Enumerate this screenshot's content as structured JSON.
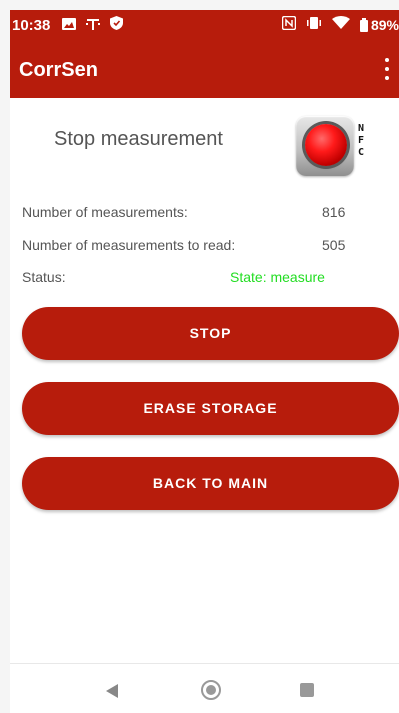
{
  "statusbar": {
    "time": "10:38",
    "battery": "89%",
    "left_icons": [
      "image-icon",
      "t-mobile-icon",
      "shield-icon"
    ],
    "right_icons": [
      "nfc-icon",
      "vibrate-icon",
      "wifi-icon",
      "battery-icon"
    ]
  },
  "appbar": {
    "title": "CorrSen"
  },
  "main": {
    "header": "Stop measurement",
    "nfc_letters": [
      "N",
      "F",
      "C"
    ],
    "nfc_led_color": "#ff1a1a",
    "rows": [
      {
        "label": "Number of measurements:",
        "value": "816"
      },
      {
        "label": "Number of measurements to read:",
        "value": "505"
      }
    ],
    "status": {
      "label": "Status:",
      "value": "State:  measure",
      "color": "#22dd22"
    }
  },
  "buttons": {
    "stop": "STOP",
    "erase": "ERASE STORAGE",
    "back": "BACK TO MAIN"
  },
  "colors": {
    "primary": "#b71c0c",
    "status_ok": "#22dd22"
  }
}
